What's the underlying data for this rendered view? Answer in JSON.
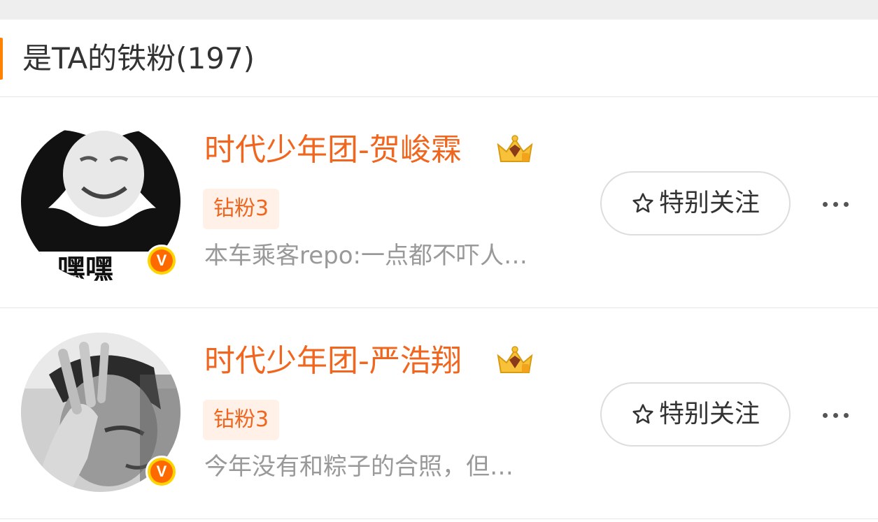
{
  "section": {
    "title": "是TA的铁粉(197)"
  },
  "fans": [
    {
      "name": "时代少年团-贺峻霖",
      "tag": "钻粉3",
      "description": "本车乘客repo:一点都不吓人…",
      "follow_label": "特别关注",
      "verified_mark": "V",
      "avatar_text": "嘿嘿"
    },
    {
      "name": "时代少年团-严浩翔",
      "tag": "钻粉3",
      "description": "今年没有和粽子的合照，但…",
      "follow_label": "特别关注",
      "verified_mark": "V"
    }
  ],
  "colors": {
    "accent": "#ff8200",
    "name": "#f0661e",
    "tag_bg": "#fff0e8",
    "verified": "#ff6a00"
  },
  "icons": [
    "crown-icon",
    "star-icon",
    "more-icon",
    "verified-icon"
  ]
}
